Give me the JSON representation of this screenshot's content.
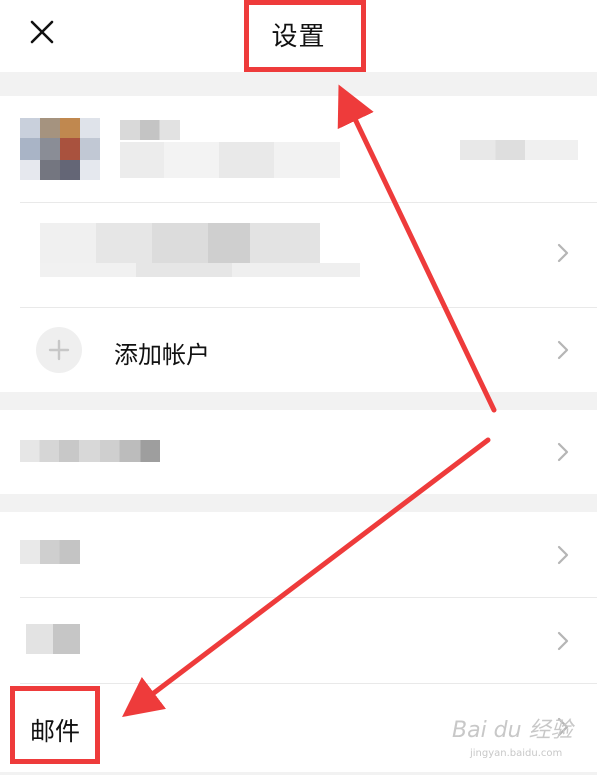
{
  "header": {
    "title": "设置",
    "close_icon": "close-icon"
  },
  "accounts": {
    "add_account_label": "添加帐户"
  },
  "bottom_group": {
    "mail_label": "邮件"
  },
  "watermark": {
    "text": "Bai du 经验",
    "sub": "jingyan.baidu.com"
  },
  "colors": {
    "highlight": "#ee3b3b",
    "chevron": "#b5b5b5",
    "separator_band": "#f2f2f2"
  }
}
